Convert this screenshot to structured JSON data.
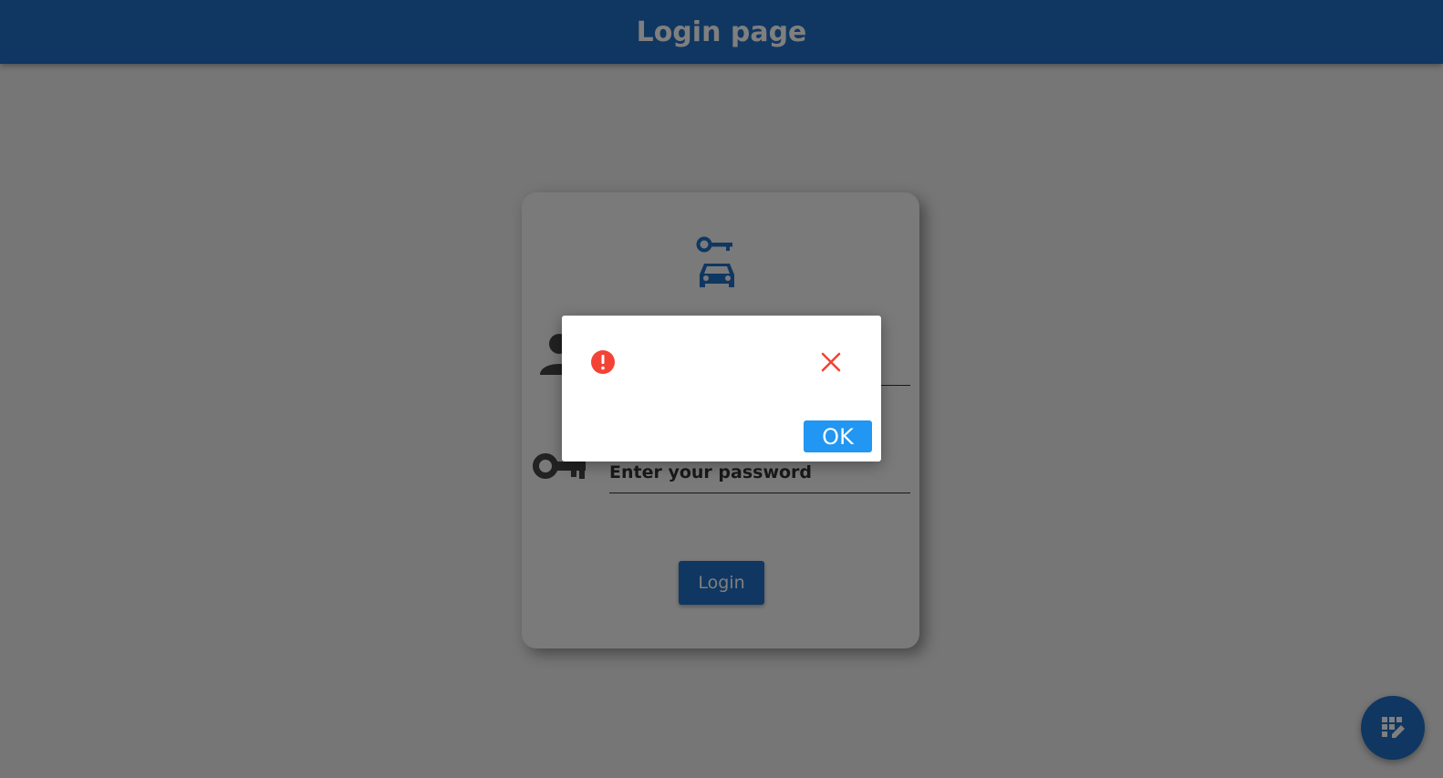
{
  "appbar": {
    "title": "Login page"
  },
  "login_form": {
    "username_placeholder": "",
    "password_placeholder": "Enter your password",
    "login_label": "Login"
  },
  "dialog": {
    "message": "",
    "ok_label": "OK"
  },
  "colors": {
    "primary": "#1f6fc4",
    "dialog_button": "#2196f3",
    "error": "#f44336"
  },
  "icons": {
    "logo": "car-key-icon",
    "username": "person-icon",
    "password": "key-icon",
    "fab": "table-edit-icon",
    "dialog_status": "error-icon",
    "dialog_close": "close-icon"
  }
}
